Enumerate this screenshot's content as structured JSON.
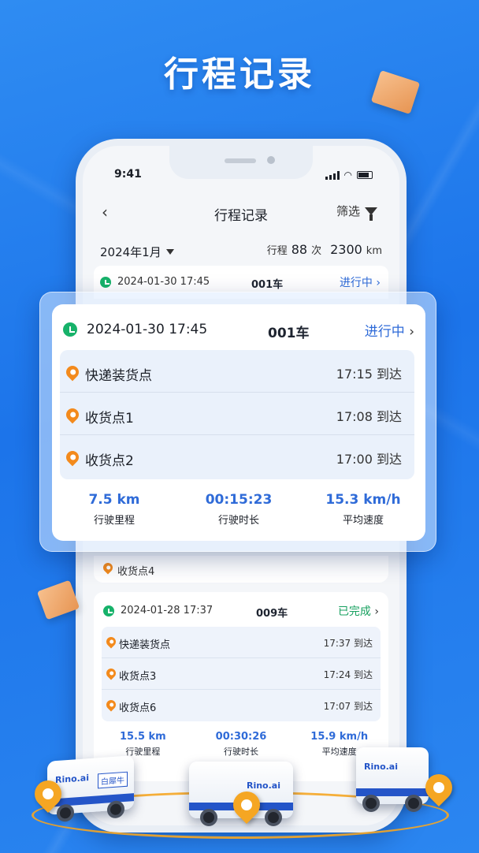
{
  "hero": {
    "title": "行程记录"
  },
  "status_bar": {
    "time": "9:41"
  },
  "nav": {
    "back_icon": "‹",
    "title": "行程记录",
    "filter_label": "筛选"
  },
  "summary": {
    "month": "2024年1月",
    "trips_label": "行程",
    "trips_count": "88",
    "trips_unit": "次",
    "distance": "2300",
    "distance_unit": "km"
  },
  "current_trip": {
    "datetime": "2024-01-30 17:45",
    "vehicle": "001车",
    "status": "进行中",
    "stops": [
      {
        "name": "快递装货点",
        "time": "17:15",
        "arrival": "到达"
      },
      {
        "name": "收货点1",
        "time": "17:08",
        "arrival": "到达"
      },
      {
        "name": "收货点2",
        "time": "17:00",
        "arrival": "到达"
      }
    ],
    "metrics": [
      {
        "value": "7.5 km",
        "label": "行驶里程"
      },
      {
        "value": "00:15:23",
        "label": "行驶时长"
      },
      {
        "value": "15.3 km/h",
        "label": "平均速度"
      }
    ]
  },
  "partial_stop": {
    "name": "收货点4"
  },
  "completed_trip": {
    "datetime": "2024-01-28 17:37",
    "vehicle": "009车",
    "status": "已完成",
    "status_color": "#17a05f",
    "stops": [
      {
        "name": "快递装货点",
        "time": "17:37",
        "arrival": "到达"
      },
      {
        "name": "收货点3",
        "time": "17:24",
        "arrival": "到达"
      },
      {
        "name": "收货点6",
        "time": "17:07",
        "arrival": "到达"
      }
    ],
    "metrics": [
      {
        "value": "15.5 km",
        "label": "行驶里程"
      },
      {
        "value": "00:30:26",
        "label": "行驶时长"
      },
      {
        "value": "15.9 km/h",
        "label": "平均速度"
      }
    ]
  },
  "vehicles": {
    "v1_logo": "Rino.ai",
    "v1_plate": "白犀牛",
    "v2_logo": "Rino.ai",
    "v3_logo": "Rino.ai"
  },
  "colors": {
    "accent": "#2f6bd8",
    "in_progress": "#2f6bd8",
    "completed": "#17a05f",
    "pin": "#f38a1c",
    "clock": "#17b26a"
  }
}
